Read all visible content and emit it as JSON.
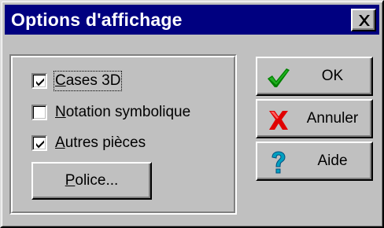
{
  "dialog": {
    "title": "Options d'affichage",
    "close_icon": "close-icon"
  },
  "options": {
    "items": [
      {
        "accel": "C",
        "rest": "ases 3D",
        "checked": true
      },
      {
        "accel": "N",
        "rest": "otation symbolique",
        "checked": false
      },
      {
        "accel": "A",
        "rest": "utres pièces",
        "checked": true
      }
    ],
    "police_button": {
      "accel": "P",
      "rest": "olice..."
    }
  },
  "buttons": {
    "ok": {
      "label": "OK",
      "icon": "checkmark-icon",
      "color": "#008000"
    },
    "cancel": {
      "label": "Annuler",
      "icon": "red-x-icon",
      "color": "#ff0000"
    },
    "help": {
      "label": "Aide",
      "icon": "question-mark-icon",
      "color": "#00a0c0"
    }
  }
}
